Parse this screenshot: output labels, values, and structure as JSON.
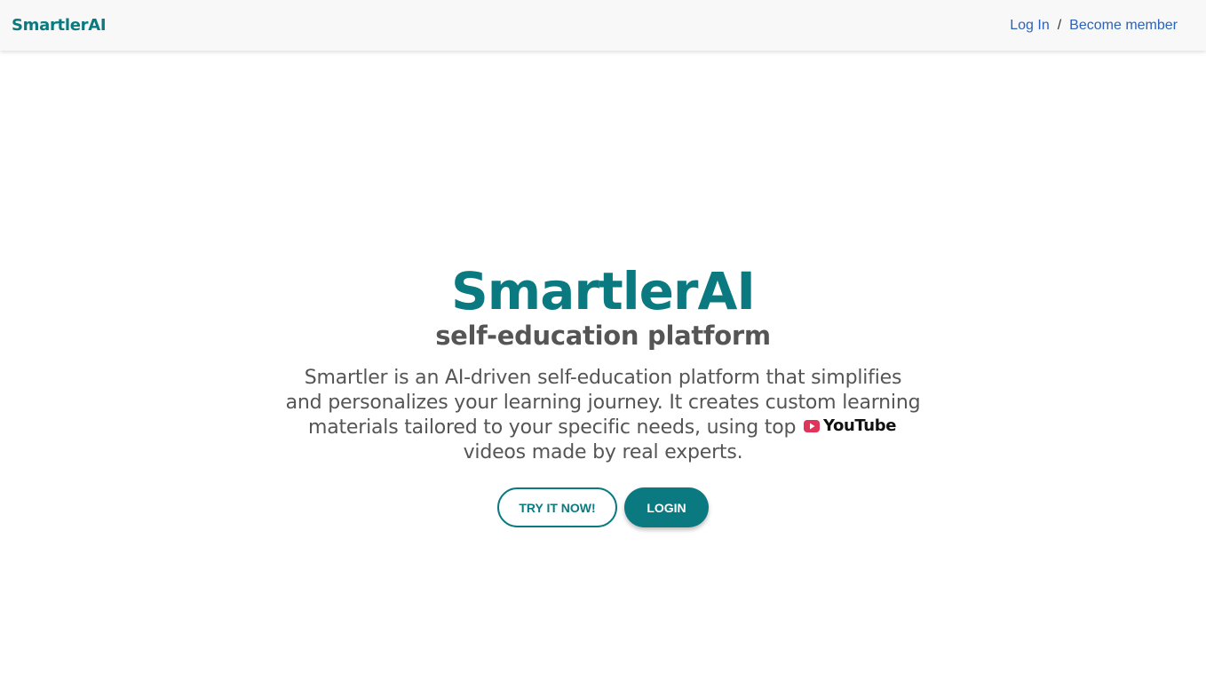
{
  "colors": {
    "brand": "#0b7a80",
    "link": "#2a63b8",
    "subtitle": "#555555",
    "description": "#555555",
    "youtube_red": "#e0345a"
  },
  "navbar": {
    "brand": "SmartlerAI",
    "login_link": "Log In",
    "separator": "/",
    "become_member_link": "Become member"
  },
  "hero": {
    "title": "SmartlerAI",
    "subtitle": "self-education platform",
    "description_before": "Smartler is an AI-driven self-education platform that simplifies and personalizes your learning journey. It creates custom learning materials tailored to your specific needs, using top",
    "youtube_label": "YouTube",
    "youtube_icon": "youtube-play-icon",
    "description_after": "videos made by real experts."
  },
  "buttons": {
    "try_label": "TRY IT NOW!",
    "login_label": "LOGIN"
  }
}
